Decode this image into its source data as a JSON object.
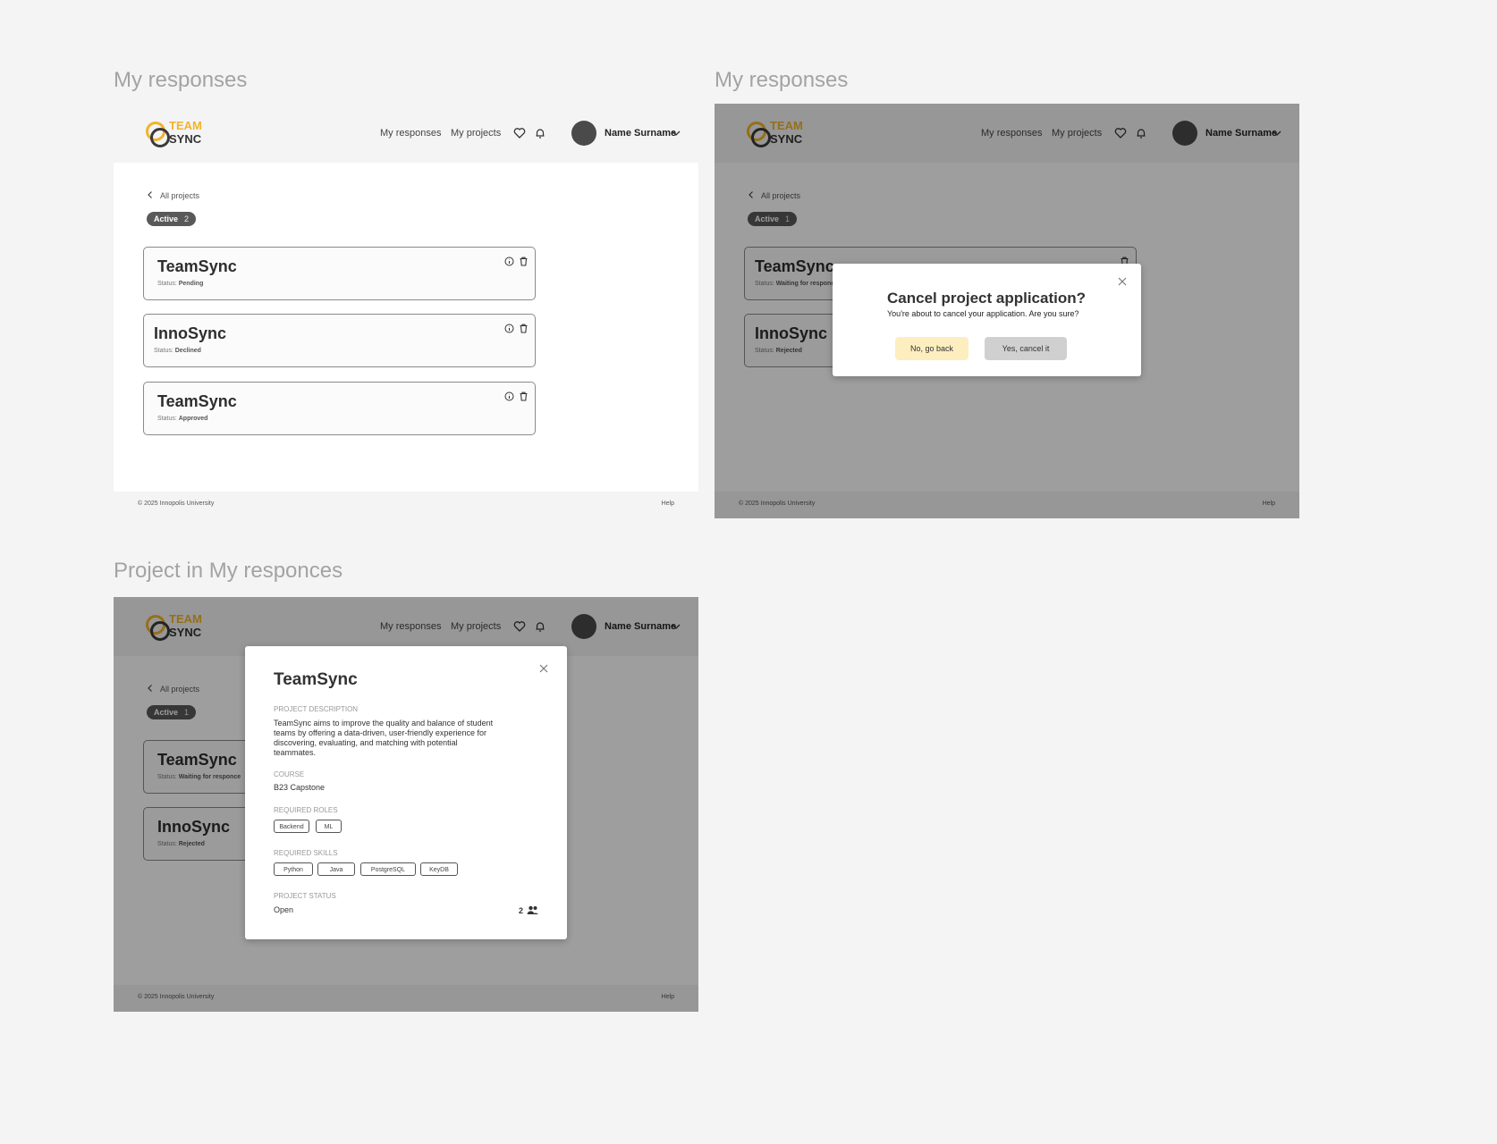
{
  "frames": {
    "f1": {
      "title": "My responses"
    },
    "f2": {
      "title": "My responses"
    },
    "f3": {
      "title": "Project in My responces"
    }
  },
  "header": {
    "logo_top": "TEAM",
    "logo_bottom": "SYNC",
    "nav_responses": "My responses",
    "nav_projects": "My projects",
    "icons": [
      "heart-icon",
      "bell-icon",
      "chevron-down-icon"
    ],
    "user_name": "Name Surname"
  },
  "back_link": "All projects",
  "footer": {
    "copyright": "© 2025 Innopolis University",
    "help": "Help"
  },
  "list1": {
    "badge_label": "Active",
    "badge_count": "2",
    "status_prefix": "Status:",
    "cards": [
      {
        "title": "TeamSync",
        "status": "Pending"
      },
      {
        "title": "InnoSync",
        "status": "Declined"
      },
      {
        "title": "TeamSync",
        "status": "Approved"
      }
    ]
  },
  "list2": {
    "badge_label": "Active",
    "badge_count": "1",
    "cards": [
      {
        "title": "TeamSync",
        "status": "Waiting for responce"
      },
      {
        "title": "InnoSync",
        "status": "Rejected"
      }
    ]
  },
  "cancel_dialog": {
    "title": "Cancel project application?",
    "message": "You're about to cancel your application. Are you sure?",
    "no_label": "No, go back",
    "yes_label": "Yes, cancel it"
  },
  "project_dialog": {
    "title": "TeamSync",
    "description_label": "PROJECT DESCRIPTION",
    "description": "TeamSync aims to improve the quality and balance of student teams by offering a data-driven, user-friendly experience for discovering, evaluating, and matching with potential teammates.",
    "course_label": "COURSE",
    "course": "B23 Capstone",
    "roles_label": "REQUIRED ROLES",
    "roles": [
      "Backend",
      "ML"
    ],
    "skills_label": "REQUIRED SKILLS",
    "skills": [
      "Python",
      "Java",
      "PostgreSQL",
      "KeyDB"
    ],
    "status_label": "PROJECT STATUS",
    "status": "Open",
    "members": "2"
  },
  "colors": {
    "accent_yellow": "#f0b429",
    "badge_gray": "#595959",
    "no_button": "#fdeec0",
    "yes_button": "#d0d0d0"
  }
}
